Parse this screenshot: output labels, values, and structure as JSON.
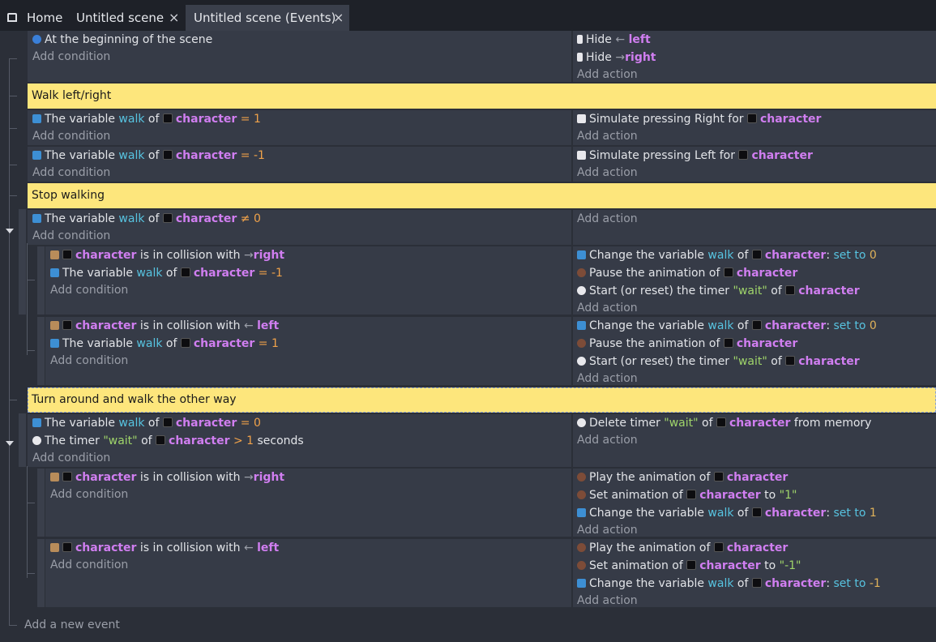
{
  "tabs": [
    {
      "label": "Home",
      "icon": "home-icon"
    },
    {
      "label": "Untitled scene",
      "close": "×"
    },
    {
      "label": "Untitled scene (Events)",
      "close": "×"
    }
  ],
  "text": {
    "add_condition": "Add condition",
    "add_action": "Add action",
    "add_event": "Add a new event",
    "the_variable": "The variable",
    "of": "of",
    "walk": "walk",
    "character": "character",
    "in_collision": "is in collision with",
    "right": "right",
    "left": "left",
    "eq1": "= 1",
    "eqm1": "= -1",
    "eq0": "= 0",
    "neq0": "≠ 0",
    "change_var": "Change the variable",
    "set_to": "set to",
    "pause_anim": "Pause the animation of",
    "start_timer": "Start (or reset) the timer",
    "wait": "\"wait\"",
    "play_anim": "Play the animation of",
    "set_anim": "Set animation of",
    "to": "to"
  },
  "events": {
    "e1": {
      "cond": "At the beginning of the scene",
      "act1": "Hide",
      "act1_obj": "left",
      "act2": "Hide",
      "act2_obj": "right"
    },
    "c1": "Walk left/right",
    "e2": {
      "act": "Simulate pressing Right for"
    },
    "e3": {
      "act": "Simulate pressing Left for"
    },
    "c2": "Stop walking",
    "c3": "Turn around and walk the other way",
    "e7": {
      "cond2a": "The timer",
      "cond2b": "> 1",
      "cond2c": "seconds",
      "act1a": "Delete timer",
      "act1b": "from memory"
    },
    "e8": {
      "anim_val": "\"1\"",
      "set_val": "1"
    },
    "e9": {
      "anim_val": "\"-1\"",
      "set_val": "-1"
    },
    "set0": "0"
  }
}
